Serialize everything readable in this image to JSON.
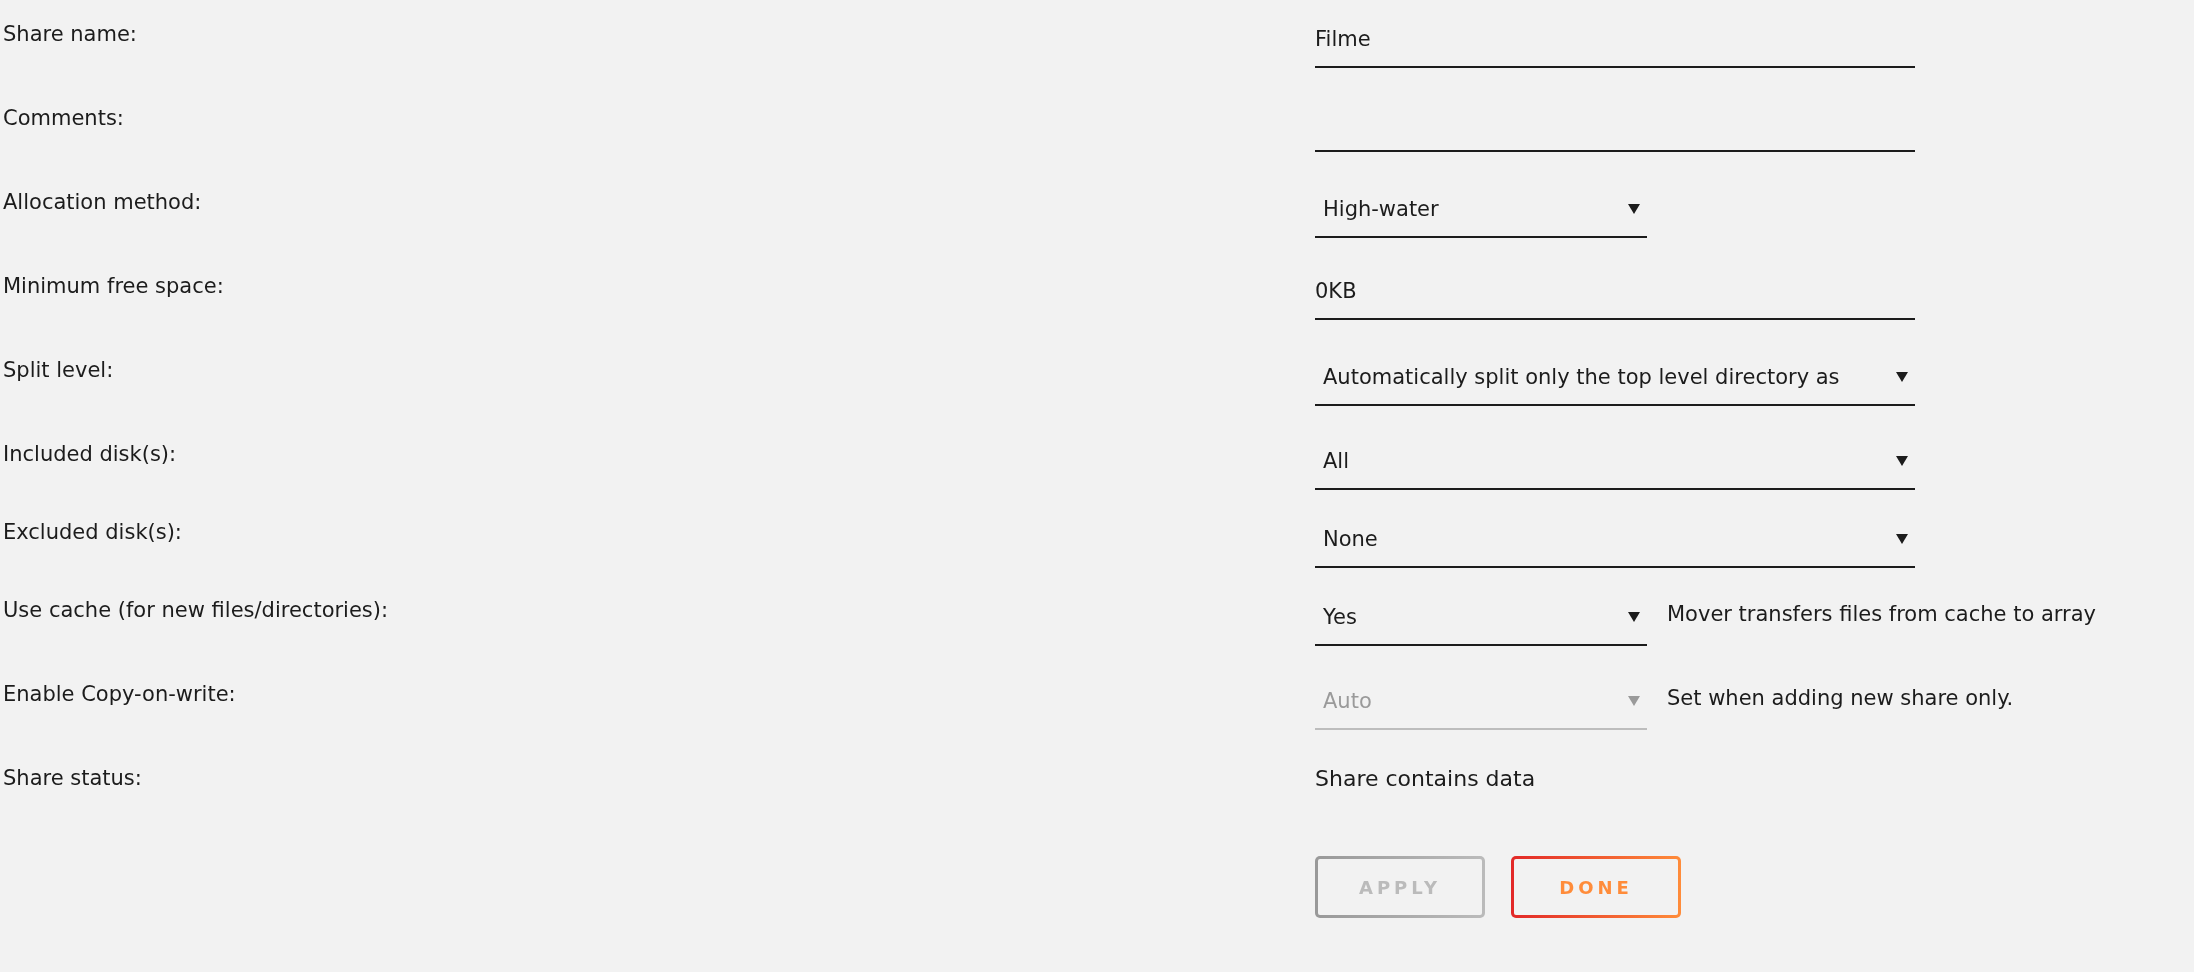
{
  "fields": [
    {
      "label": "Share name:",
      "kind": "text",
      "value": "Filme"
    },
    {
      "label": "Comments:",
      "kind": "text"
    },
    {
      "label": "Allocation method:",
      "kind": "short-select",
      "value": "High-water",
      "disabled": false
    },
    {
      "label": "Minimum free space:",
      "kind": "text",
      "value": "0KB"
    },
    {
      "label": "Split level:",
      "kind": "select",
      "value": "Automatically split only the top level directory as",
      "disabled": false
    },
    {
      "label": "Included disk(s):",
      "kind": "select",
      "value": "All",
      "disabled": false
    },
    {
      "label": "Excluded disk(s):",
      "kind": "select",
      "value": "None",
      "disabled": false
    },
    {
      "label": "Use cache (for new files/directories):",
      "kind": "short-select",
      "value": "Yes",
      "disabled": false,
      "note": "Mover transfers files from cache to array"
    },
    {
      "label": "Enable Copy-on-write:",
      "kind": "short-select",
      "value": "Auto",
      "disabled": true,
      "note": "Set when adding new share only."
    },
    {
      "label": "Share status:",
      "kind": "static",
      "value": "Share contains data"
    }
  ],
  "buttons": [
    {
      "label": "APPLY",
      "disabled": true
    },
    {
      "label": "DONE",
      "disabled": false
    }
  ]
}
